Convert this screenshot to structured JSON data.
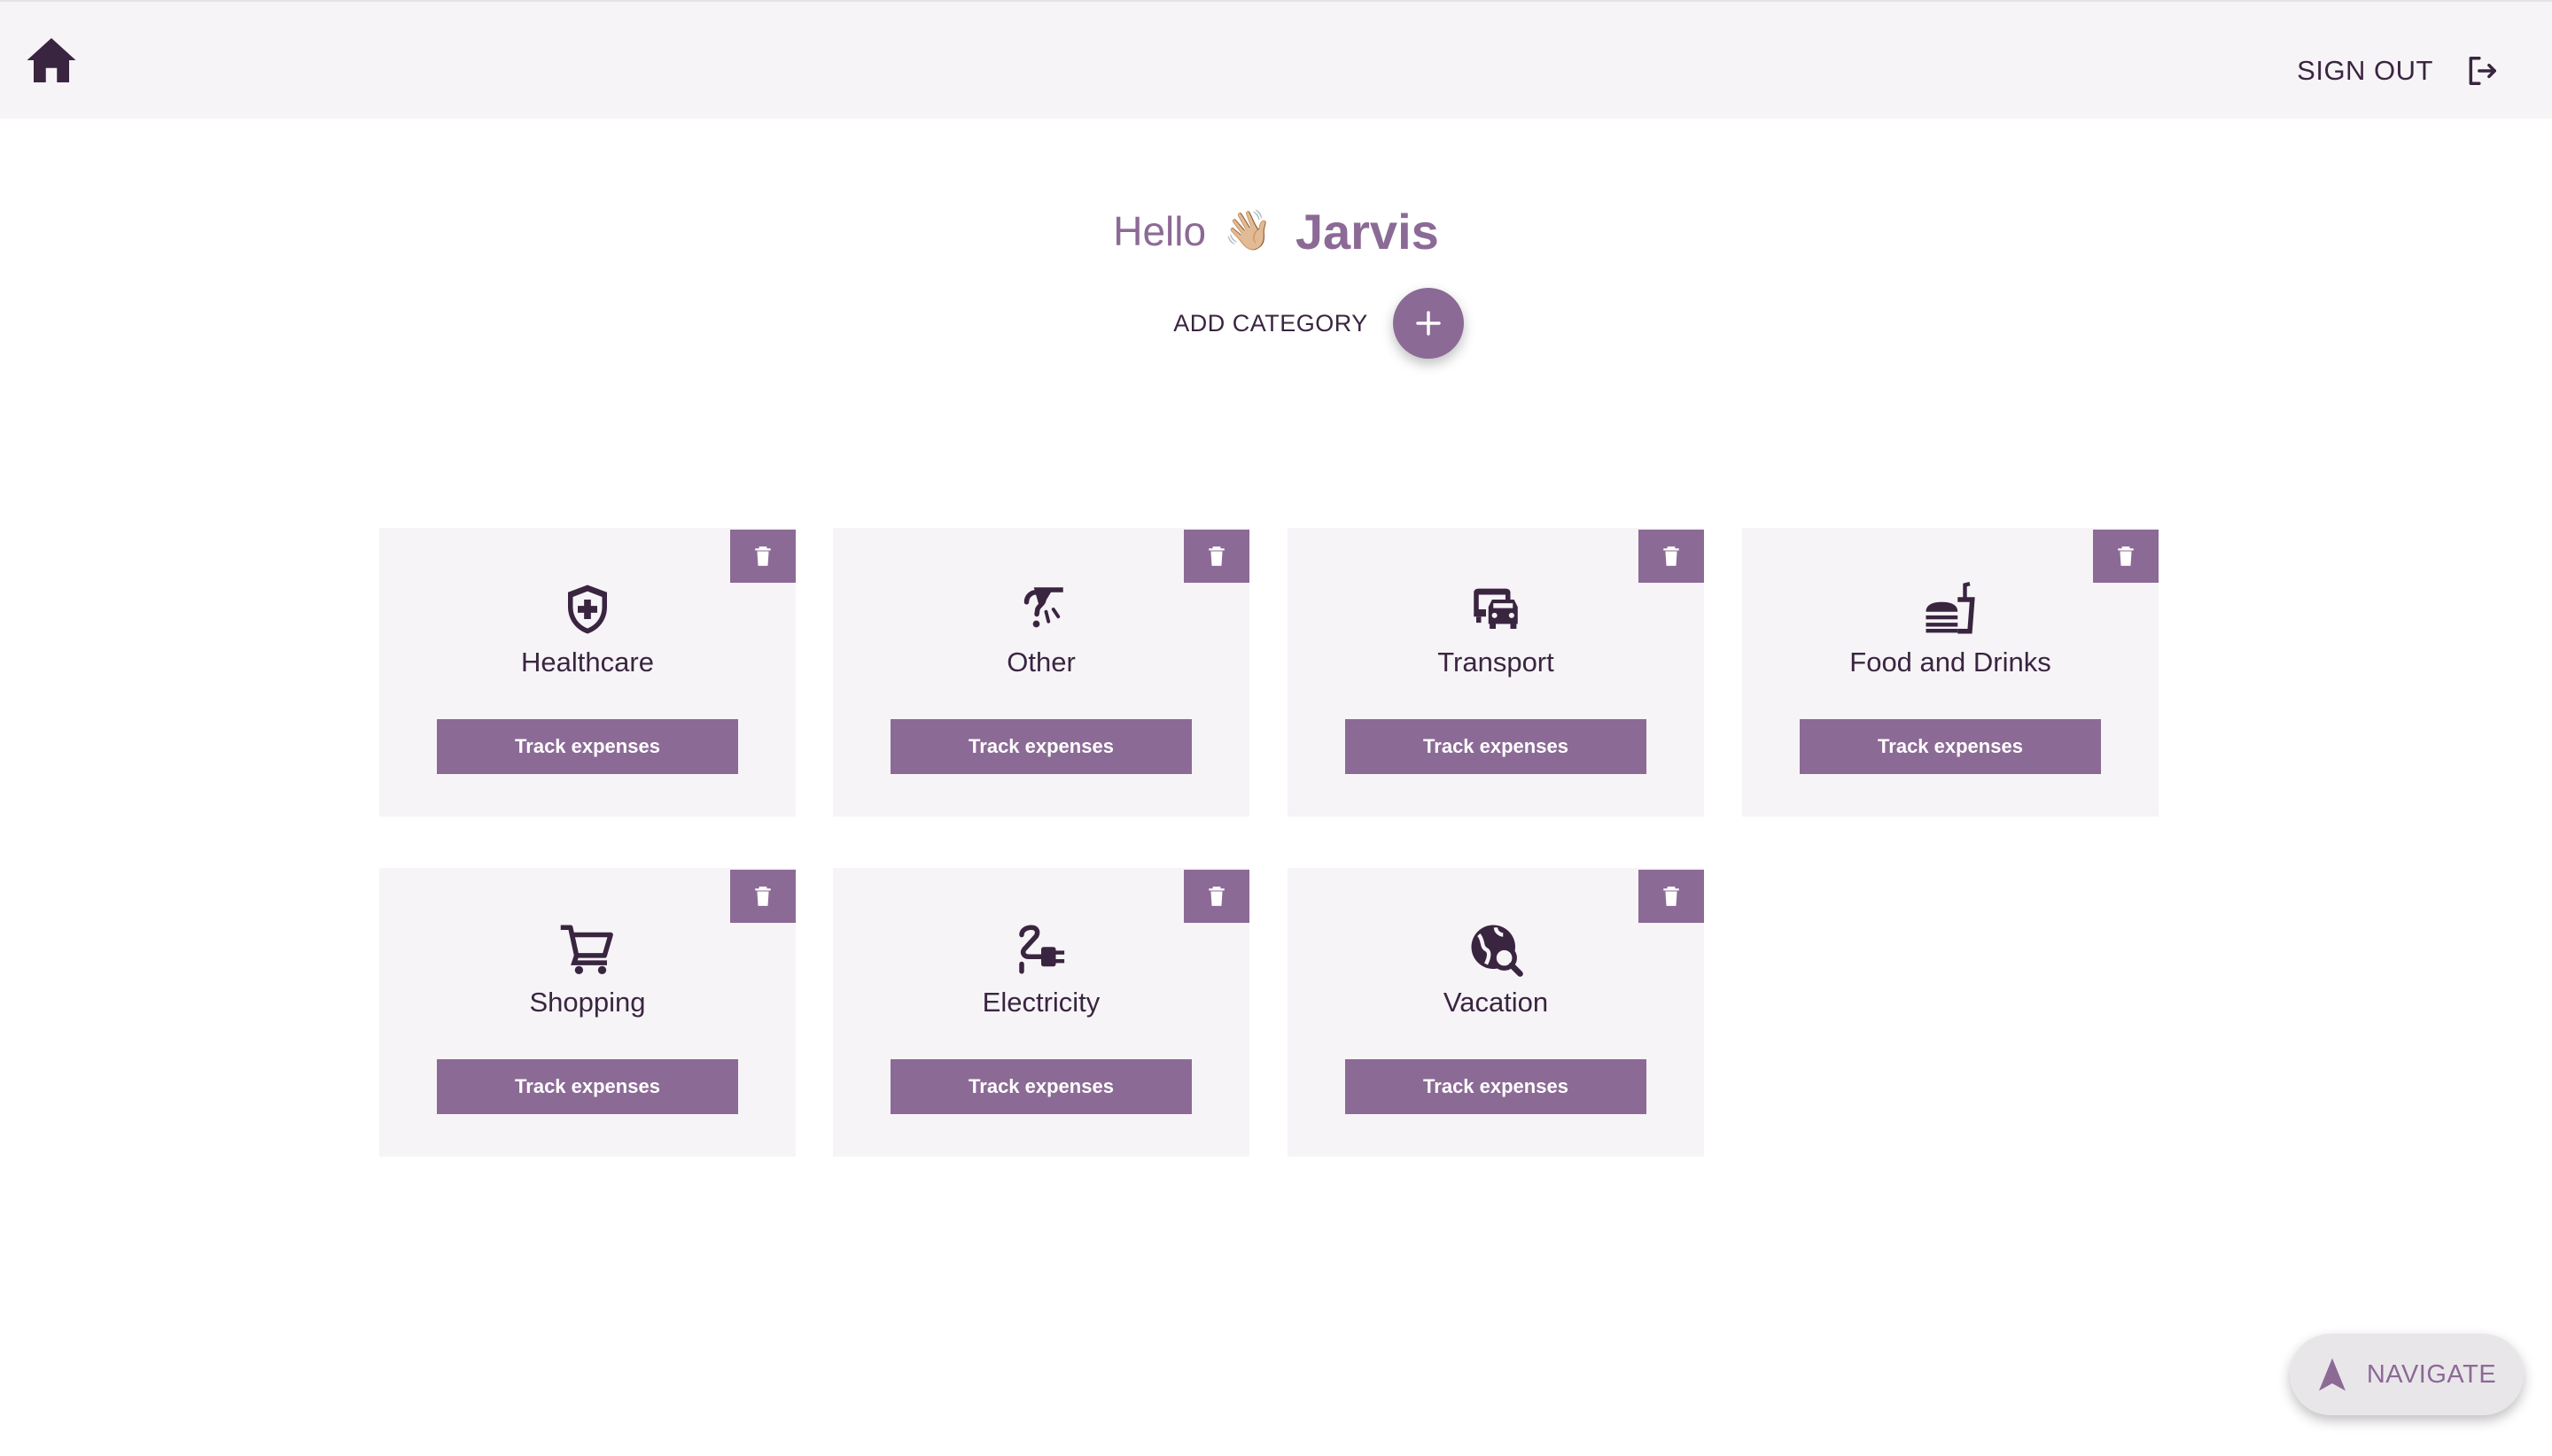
{
  "colors": {
    "accent": "#8c6a96",
    "dark": "#3a2540",
    "card_bg": "#f6f4f7",
    "topbar_bg": "#f6f4f7"
  },
  "header": {
    "home_icon": "home-icon",
    "signout_label": "SIGN OUT",
    "signout_icon": "logout-icon"
  },
  "greeting": {
    "hello": "Hello",
    "wave_emoji": "👋🏼",
    "username": "Jarvis"
  },
  "add_category": {
    "label": "ADD CATEGORY",
    "icon": "plus-icon"
  },
  "categories": [
    {
      "title": "Healthcare",
      "icon": "shield-medical-icon",
      "button": "Track expenses"
    },
    {
      "title": "Other",
      "icon": "question-hand-icon",
      "button": "Track expenses"
    },
    {
      "title": "Transport",
      "icon": "bus-car-icon",
      "button": "Track expenses"
    },
    {
      "title": "Food and Drinks",
      "icon": "burger-drink-icon",
      "button": "Track expenses"
    },
    {
      "title": "Shopping",
      "icon": "cart-icon",
      "button": "Track expenses"
    },
    {
      "title": "Electricity",
      "icon": "plug-icon",
      "button": "Track expenses"
    },
    {
      "title": "Vacation",
      "icon": "globe-search-icon",
      "button": "Track expenses"
    }
  ],
  "navigate": {
    "label": "NAVIGATE",
    "icon": "navigation-arrow-icon"
  }
}
